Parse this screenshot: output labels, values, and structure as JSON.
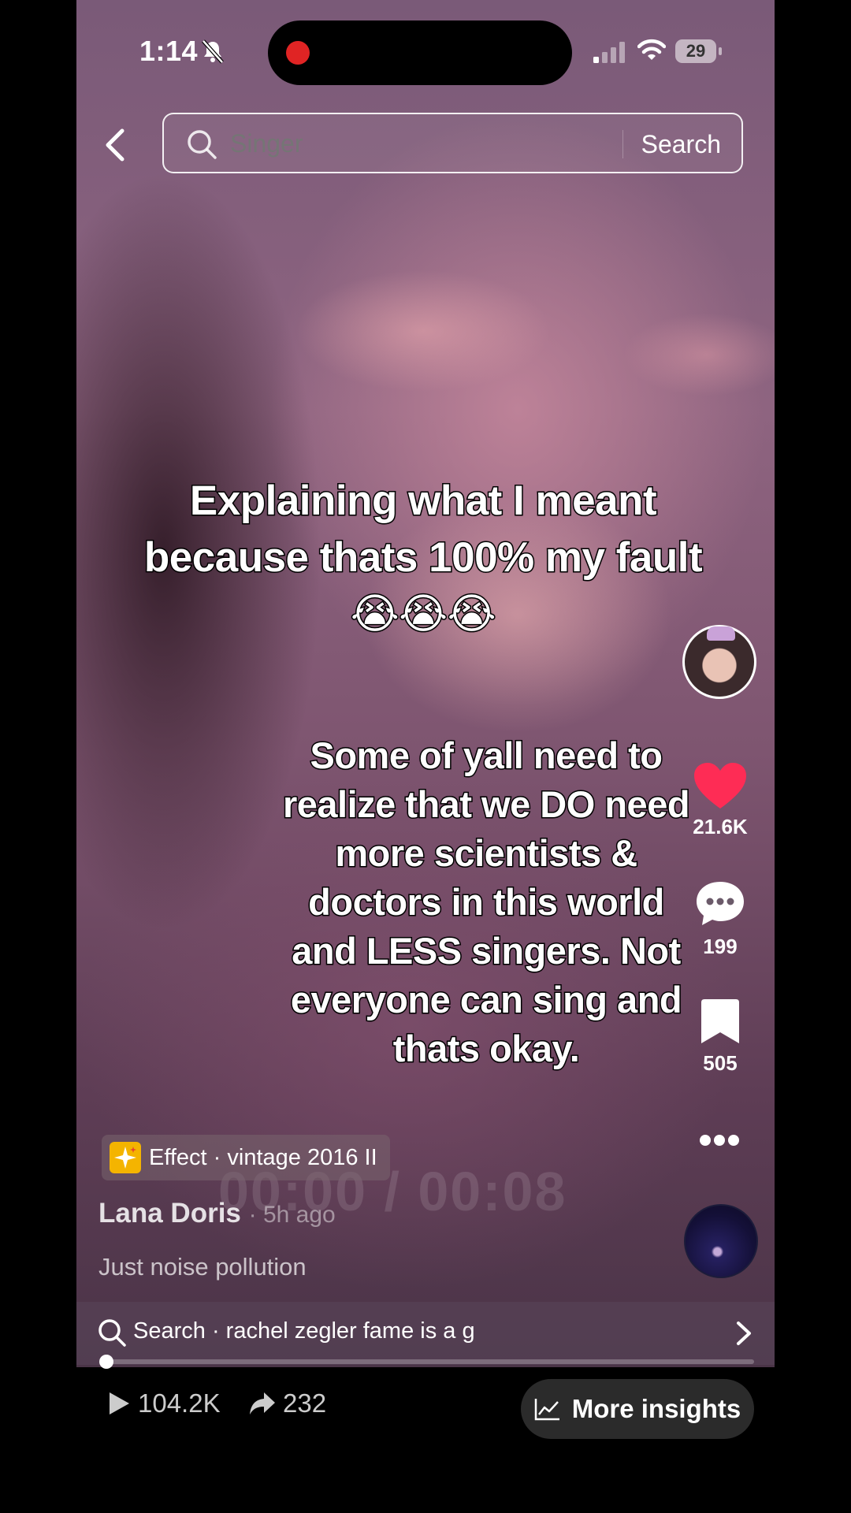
{
  "status_bar": {
    "time": "1:14",
    "battery": "29"
  },
  "search": {
    "placeholder": "Singer",
    "button_label": "Search"
  },
  "video": {
    "caption_top": "Explaining what I meant because thats 100% my fault😭😭😭",
    "caption_main": "Some of yall need to realize that we DO need more scientists & doctors in this world and LESS singers. Not everyone can sing and thats okay.",
    "timer": "00:00 / 00:08",
    "progress": 0.0
  },
  "actions": {
    "likes": "21.6K",
    "comments": "199",
    "saves": "505",
    "like_color": "#fe2c55"
  },
  "effect": {
    "label": "Effect · vintage 2016 II"
  },
  "comment_preview": {
    "author": "Lana Doris",
    "time": "· 5h ago",
    "text": "Just noise pollution"
  },
  "related_search": {
    "text": "Search · rachel zegler fame is a g"
  },
  "stats": {
    "views": "104.2K",
    "shares": "232",
    "insights_label": "More insights"
  }
}
